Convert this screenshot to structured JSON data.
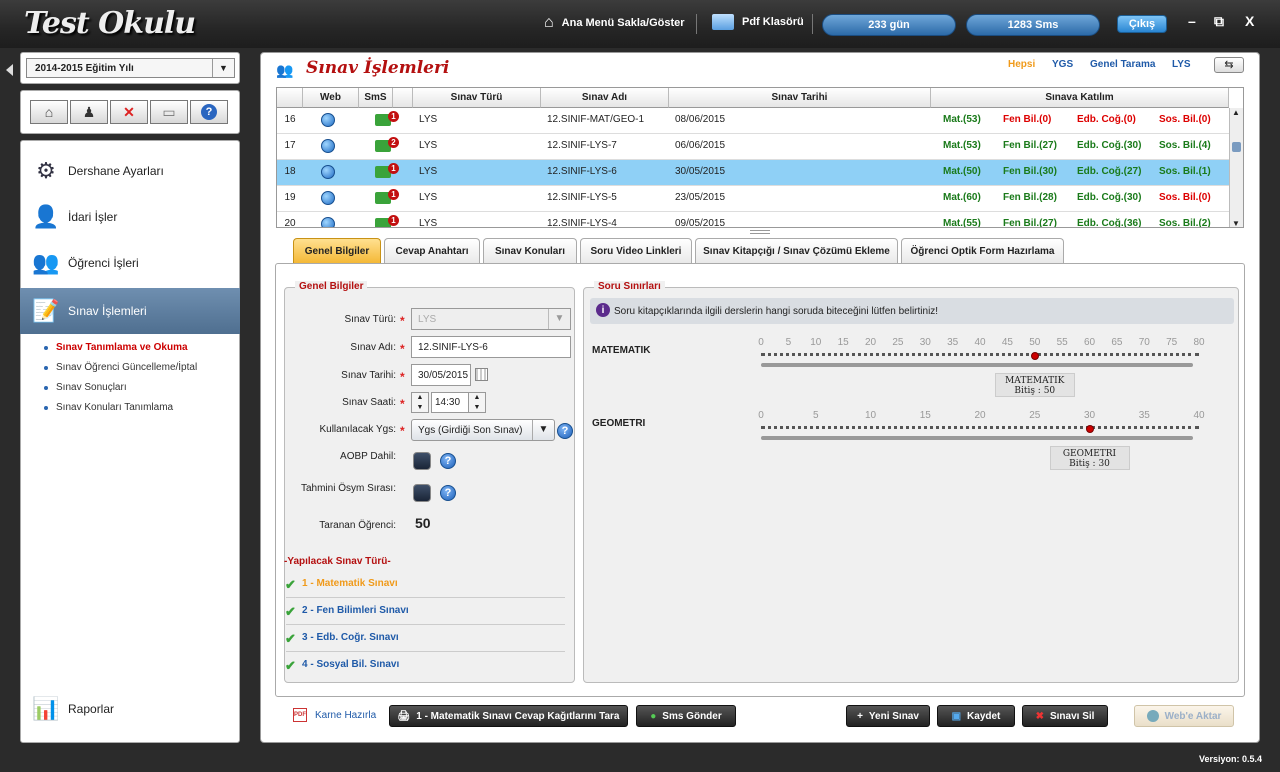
{
  "app": {
    "logo": "Test Okulu",
    "version": "Versiyon: 0.5.4"
  },
  "topbar": {
    "menu_toggle": "Ana Menü Sakla/Göster",
    "pdf": "Pdf Klasörü",
    "days": "233 gün",
    "sms": "1283 Sms",
    "logout": "Çıkış",
    "minimize": "–",
    "restore": "⧉",
    "close": "X"
  },
  "sidebar": {
    "year": "2014-2015 Eğitim Yılı",
    "menu": [
      {
        "label": "Dershane Ayarları",
        "icon": "gear-icon"
      },
      {
        "label": "İdari İşler",
        "icon": "admin-user-icon"
      },
      {
        "label": "Öğrenci İşleri",
        "icon": "students-icon"
      },
      {
        "label": "Sınav İşlemleri",
        "icon": "exam-icon"
      }
    ],
    "submenu": [
      "Sınav Tanımlama ve Okuma",
      "Sınav Öğrenci Güncelleme/İptal",
      "Sınav Sonuçları",
      "Sınav Konuları Tanımlama"
    ],
    "reports": "Raporlar"
  },
  "main": {
    "title": "Sınav İşlemleri",
    "filters": [
      "Hepsi",
      "YGS",
      "Genel Tarama",
      "LYS"
    ]
  },
  "table": {
    "headers": [
      "Web",
      "SmS",
      "Sınav Türü",
      "Sınav Adı",
      "Sınav Tarihi",
      "Sınava Katılım"
    ],
    "rows": [
      {
        "no": "16",
        "sms": "1",
        "type": "LYS",
        "name": "12.SINIF-MAT/GEO-1",
        "date": "08/06/2015",
        "k": [
          [
            "Mat.(53)",
            "g"
          ],
          [
            "Fen Bil.(0)",
            "r"
          ],
          [
            "Edb. Coğ.(0)",
            "r"
          ],
          [
            "Sos. Bil.(0)",
            "r"
          ]
        ]
      },
      {
        "no": "17",
        "sms": "2",
        "type": "LYS",
        "name": "12.SINIF-LYS-7",
        "date": "06/06/2015",
        "k": [
          [
            "Mat.(53)",
            "g"
          ],
          [
            "Fen Bil.(27)",
            "g"
          ],
          [
            "Edb. Coğ.(30)",
            "g"
          ],
          [
            "Sos. Bil.(4)",
            "g"
          ]
        ]
      },
      {
        "no": "18",
        "sms": "1",
        "type": "LYS",
        "name": "12.SINIF-LYS-6",
        "date": "30/05/2015",
        "k": [
          [
            "Mat.(50)",
            "g"
          ],
          [
            "Fen Bil.(30)",
            "g"
          ],
          [
            "Edb. Coğ.(27)",
            "g"
          ],
          [
            "Sos. Bil.(1)",
            "g"
          ]
        ]
      },
      {
        "no": "19",
        "sms": "1",
        "type": "LYS",
        "name": "12.SINIF-LYS-5",
        "date": "23/05/2015",
        "k": [
          [
            "Mat.(60)",
            "g"
          ],
          [
            "Fen Bil.(28)",
            "g"
          ],
          [
            "Edb. Coğ.(30)",
            "g"
          ],
          [
            "Sos. Bil.(0)",
            "r"
          ]
        ]
      },
      {
        "no": "20",
        "sms": "1",
        "type": "LYS",
        "name": "12.SINIF-LYS-4",
        "date": "09/05/2015",
        "k": [
          [
            "Mat.(55)",
            "g"
          ],
          [
            "Fen Bil.(27)",
            "g"
          ],
          [
            "Edb. Coğ.(36)",
            "g"
          ],
          [
            "Sos. Bil.(2)",
            "g"
          ]
        ]
      }
    ]
  },
  "tabs": [
    "Genel Bilgiler",
    "Cevap Anahtarı",
    "Sınav Konuları",
    "Soru Video Linkleri",
    "Sınav Kitapçığı / Sınav Çözümü Ekleme",
    "Öğrenci Optik Form Hazırlama"
  ],
  "genel": {
    "group": "Genel Bilgiler",
    "type_label": "Sınav Türü:",
    "type_value": "LYS",
    "name_label": "Sınav Adı:",
    "name_value": "12.SINIF-LYS-6",
    "date_label": "Sınav Tarihi:",
    "date_value": "30/05/2015",
    "time_label": "Sınav Saati:",
    "time_value": "14:30",
    "ygs_label": "Kullanılacak Ygs:",
    "ygs_value": "Ygs (Girdiği Son Sınav)",
    "aobp_label": "AOBP Dahil:",
    "osym_label": "Tahmini Ösym Sırası:",
    "taranan_label": "Taranan Öğrenci:",
    "taranan_value": "50",
    "yap_title": "-Yapılacak Sınav Türü-",
    "yap": [
      {
        "label": "1 - Matematik Sınavı",
        "color": "#f09a1a"
      },
      {
        "label": "2 - Fen Bilimleri Sınavı",
        "color": "#1f5aa8"
      },
      {
        "label": "3 - Edb. Coğr. Sınavı",
        "color": "#1f5aa8"
      },
      {
        "label": "4 - Sosyal Bil. Sınavı",
        "color": "#1f5aa8"
      }
    ]
  },
  "soru": {
    "group": "Soru Sınırları",
    "info": "Soru kitapçıklarında ilgili derslerin hangi soruda biteceğini lütfen belirtiniz!",
    "sliders": [
      {
        "label": "MATEMATIK",
        "max": 80,
        "step": 5,
        "value": 50,
        "tip_title": "MATEMATIK",
        "tip_sub": "Bitiş : 50"
      },
      {
        "label": "GEOMETRI",
        "max": 40,
        "step": 5,
        "value": 30,
        "tip_title": "GEOMETRI",
        "tip_sub": "Bitiş : 30"
      }
    ]
  },
  "bottom": {
    "karne": "Karne Hazırla",
    "tara": "1 - Matematik Sınavı Cevap Kağıtlarını Tara",
    "sms": "Sms Gönder",
    "yeni": "Yeni Sınav",
    "kaydet": "Kaydet",
    "sil": "Sınavı Sil",
    "web": "Web'e Aktar"
  }
}
